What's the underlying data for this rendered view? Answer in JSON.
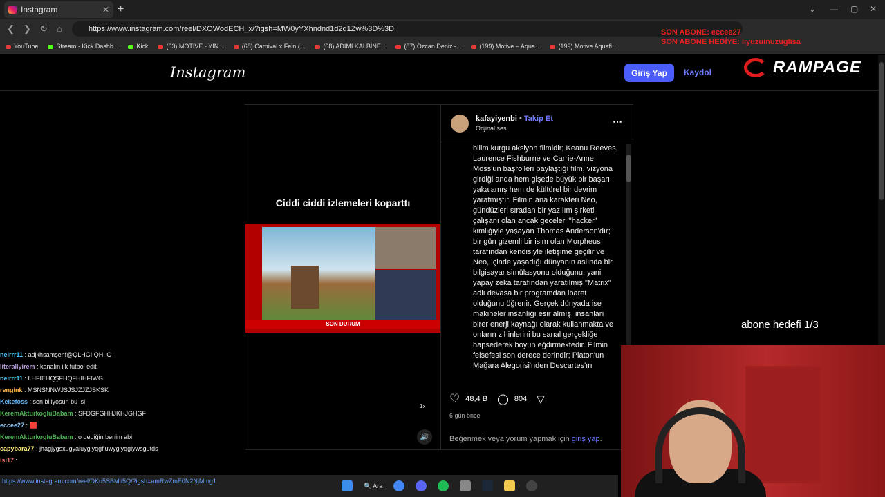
{
  "browser": {
    "tab_title": "Instagram",
    "url": "https://www.instagram.com/reel/DXOWodECH_x/?igsh=MW0yYXhndnd1d2d1Zw%3D%3D",
    "bookmarks": [
      "YouTube",
      "Stream - Kick Dashb...",
      "Kick",
      "(63) MOTIVE - YIN...",
      "(68) Carnival x Fein (...",
      "(68) ADIMI KALBİNE...",
      "(87) Özcan Deniz -...",
      "(199) Motive – Aqua...",
      "(199) Motive Aquafi..."
    ]
  },
  "stream_overlay": {
    "last_sub": "SON ABONE: eccee27",
    "last_gift": "SON ABONE HEDİYE: liyuzuinuzuglisa",
    "sub_goal": "abone hedefi 1/3"
  },
  "instagram": {
    "logo": "Instagram",
    "login_label": "Giriş Yap",
    "signup_label": "Kaydol",
    "sponsor": "RAMPAGE",
    "video": {
      "caption": "Ciddi ciddi izlemeleri koparttı",
      "ticker": "SON DURUM",
      "speed": "1x"
    },
    "post": {
      "username": "kafayiyenbi",
      "follow_label": "Takip Et",
      "audio": "Orijinal ses",
      "description": "bilim kurgu aksiyon filmidir; Keanu Reeves, Laurence Fishburne ve Carrie-Anne Moss'un başrolleri paylaştığı film, vizyona girdiği anda hem gişede büyük bir başarı yakalamış hem de kültürel bir devrim yaratmıştır. Filmin ana karakteri Neo, gündüzleri sıradan bir yazılım şirketi çalışanı olan ancak geceleri \"hacker\" kimliğiyle yaşayan Thomas Anderson'dır; bir gün gizemli bir isim olan Morpheus tarafından kendisiyle iletişime geçilir ve Neo, içinde yaşadığı dünyanın aslında bir bilgisayar simülasyonu olduğunu, yani yapay zeka tarafından yaratılmış \"Matrix\" adlı devasa bir programdan ibaret olduğunu öğrenir. Gerçek dünyada ise makineler insanlığı esir almış, insanları birer enerji kaynağı olarak kullanmakta ve onların zihinlerini bu sanal gerçekliğe hapsederek boyun eğdirmektedir. Filmin felsefesi son derece derindir; Platon'un Mağara Alegorisi'nden Descartes'ın",
      "likes": "48,4 B",
      "comments": "804",
      "time_ago": "6 gün önce",
      "login_prompt": "Beğenmek veya yorum yapmak için",
      "login_link": "giriş yap"
    }
  },
  "chat": [
    {
      "user": "neirrr11",
      "color": "#4fc3f7",
      "msg": "adjkhsamşenf@QLHGI QHI G"
    },
    {
      "user": "literallyirem",
      "color": "#b39ddb",
      "msg": "kanalın ilk futbol editi"
    },
    {
      "user": "neirrr11",
      "color": "#4fc3f7",
      "msg": "LHFIEHQŞFHQFHIHFIWG"
    },
    {
      "user": "rengink",
      "color": "#ffb74d",
      "msg": "MSNSNNWJSJSJZJZJSKSK"
    },
    {
      "user": "Kekefoss",
      "color": "#64b5f6",
      "msg": "sen biliyosun bu isi"
    },
    {
      "user": "KeremAkturkogluBabam",
      "color": "#4caf50",
      "msg": "SFDGFGHHJKHJGHGF"
    },
    {
      "user": "eccee27",
      "color": "#90caf9",
      "msg": "🟥"
    },
    {
      "user": "KeremAkturkogluBabam",
      "color": "#4caf50",
      "msg": "o dediğin benim abi"
    },
    {
      "user": "capybara77",
      "color": "#fff176",
      "msg": "jhagjygsxugyaiuygiyqgfiuwygiyqgiywsgutds"
    },
    {
      "user": "isi17",
      "color": "#e57373",
      "msg": ""
    }
  ],
  "link_preview": "https://www.instagram.com/reel/DKu5SBMIi5Q/?igsh=amRwZmE0N2NjMmg1",
  "taskbar": {
    "search_label": "Ara"
  }
}
